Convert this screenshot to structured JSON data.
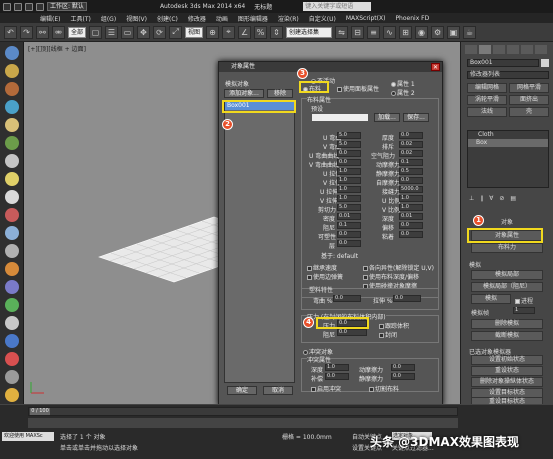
{
  "titlebar": {
    "workspace": "工作区: 默认",
    "app_title": "Autodesk 3ds Max  2014 x64",
    "doc": "无标题",
    "search_placeholder": "键入关键字或短语"
  },
  "menu": [
    "编辑(E)",
    "工具(T)",
    "组(G)",
    "视图(V)",
    "创建(C)",
    "修改器",
    "动画",
    "图形编辑器",
    "渲染(R)",
    "自定义(U)",
    "MAXScript(X)",
    "Phoenix FD"
  ],
  "toolbar": {
    "selection_filter": "全部",
    "ref_coord": "视图",
    "create_sel": "创建选择集"
  },
  "viewport": {
    "label": "[+][顶][线框 + 边面]"
  },
  "dialog": {
    "title": "对象属性",
    "sim_group": "模拟对象",
    "add_obj": "添加对象...",
    "remove": "移除",
    "list_item": "Box001",
    "inactive": "不活动",
    "cloth": "布料",
    "use_panel_prop": "使用面板属性",
    "prop1": "属性 1",
    "prop2": "属性 2",
    "cloth_prop": "布料属性",
    "preset": "预设",
    "load": "加载...",
    "save": "保存...",
    "u_bend": "U 弯曲",
    "v_bend": "V 弯曲",
    "u_bcurve": "U 弯曲曲线",
    "v_bcurve": "V 弯曲曲线",
    "u_stretch": "U 拉伸",
    "v_stretch": "V 拉伸",
    "shear": "剪切力",
    "density": "密度",
    "damping": "阻尼",
    "plasticity": "可塑性",
    "thickness": "厚度",
    "repulsion": "排斥",
    "air_res": "空气阻力",
    "dyn_fric": "动摩擦力",
    "stat_fric": "静摩擦力",
    "self_fric": "自摩擦力",
    "seam_force": "接缝力",
    "u_scale": "U 比例",
    "v_scale": "V 比例",
    "depth": "深度",
    "offset": "偏移",
    "cling": "粘着",
    "val_a": "5.0",
    "val_b": "0.0",
    "val_c": "0.02",
    "val_d": "0.1",
    "val_e": "0.5",
    "val_f": "1.0",
    "val_g": "5000.0",
    "val_h": "0.01",
    "val_i": "1.0",
    "layer": "层",
    "based_on": "基于: default",
    "anisotropic": "各向异性(解除锁定 U,V)",
    "use_edge": "使用边弹簧",
    "tension": "继承速度",
    "use_solid_fric": "使用布料深度/偏移",
    "use_cloth_depth": "使用碰撞对象摩擦",
    "pressure_group": "压力 (在封闭的布料体积内部)",
    "pressure_label": "压力",
    "pressure_val": "0.0",
    "track_vol": "跟踪体积",
    "damping2": "阻尼",
    "cap": "封闭",
    "plastic_group": "塑料特性",
    "bend_pct": "弯曲 %",
    "stretch_pct": "拉伸 %",
    "bend_val": "0.0",
    "stretch_val": "0.0",
    "collide_group": "冲突对象",
    "collide_prop": "冲突属性",
    "depth2": "深度",
    "offset2": "补偿",
    "dyn_fric2": "动摩擦力",
    "stat_fric2": "静摩擦力",
    "dval1": "1.0",
    "dval2": "0.0",
    "dval3": "0.0",
    "dval4": "0.0",
    "enable_collide": "启用冲突",
    "cut_cloth": "切割布料",
    "ok": "确定",
    "cancel": "取消"
  },
  "rpanel": {
    "obj_name": "Box001",
    "mod_list": "修改器列表",
    "btns": [
      "编辑网格",
      "网格平滑",
      "涡轮平滑",
      "面挤出",
      "法线",
      "壳"
    ],
    "stack": [
      "Cloth",
      "Box"
    ],
    "object_title": "对象",
    "obj_props": "对象属性",
    "cloth_force": "布料力",
    "sim_title": "模拟",
    "local_sim": "模拟局部",
    "local_damp": "模拟局部（阻尼）",
    "simulate": "模拟",
    "progress": "进程",
    "sim_frames": "模拟帧",
    "frame_val": "1",
    "erase_sim": "删除模拟",
    "trunc_sim": "截断模拟",
    "states": "已选对象模拟器",
    "set_init": "设置初始状态",
    "reset_state": "重设状态",
    "del_target": "删除对象操纵体状态",
    "set_target": "设置目标状态",
    "reset_target": "重设目标状态",
    "use_target": "使用目标状态"
  },
  "bottom": {
    "frame_counter": "0 / 100",
    "selected": "选择了 1 个 对象",
    "hint": "单击或单击并拖动以选择对象",
    "grid": "栅格 = 100.0mm",
    "auto_key": "自动关键点",
    "sel_obj": "选定对象",
    "set_key": "设置关键点",
    "key_filter": "关键点过滤器...",
    "welcome": "欢迎使用 MAXSc",
    "watermark": "头条 @3DMAX效果图表现"
  },
  "markers": [
    "1",
    "2",
    "3",
    "4"
  ],
  "colors": {
    "highlight": "#f1d91e",
    "marker": "#e8502b",
    "selection": "#5a8fd6"
  }
}
